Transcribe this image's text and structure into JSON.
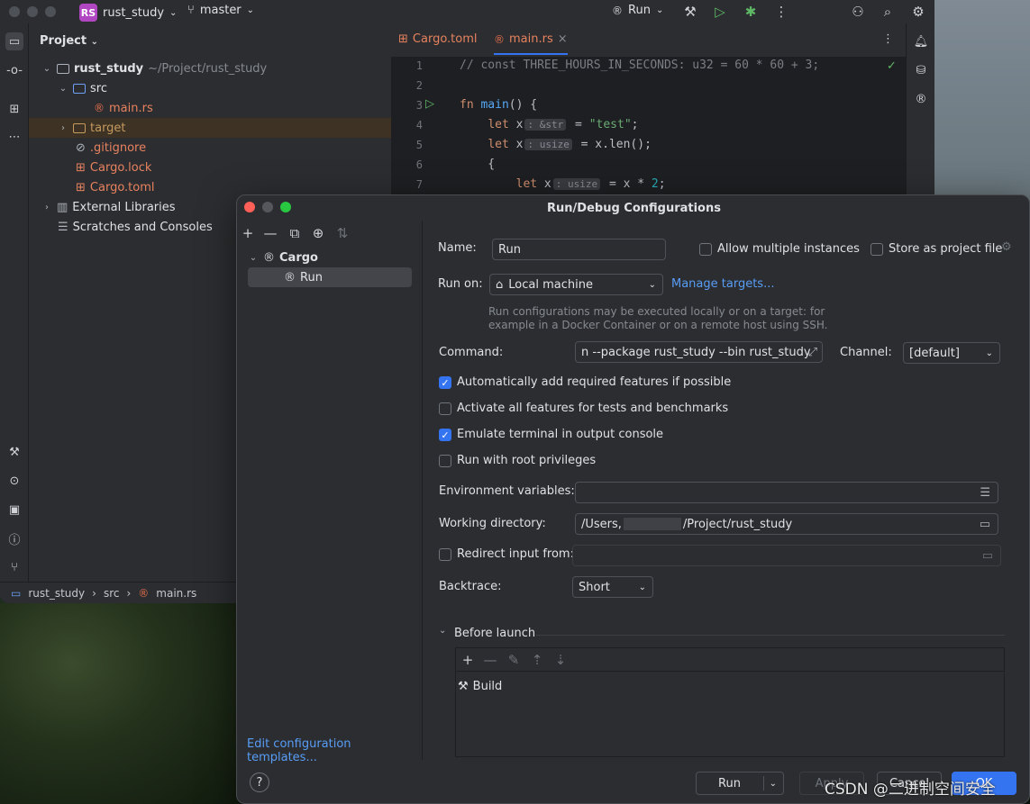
{
  "titlebar": {
    "project_badge": "RS",
    "project_name": "rust_study",
    "branch": "master",
    "run_label": "Run"
  },
  "project_panel": {
    "title": "Project",
    "root_name": "rust_study",
    "root_path": "~/Project/rust_study",
    "items": [
      "src",
      "main.rs",
      "target",
      ".gitignore",
      "Cargo.lock",
      "Cargo.toml",
      "External Libraries",
      "Scratches and Consoles"
    ]
  },
  "editor": {
    "tabs": [
      "Cargo.toml",
      "main.rs"
    ],
    "line_numbers": [
      "1",
      "2",
      "3",
      "4",
      "5",
      "6",
      "7"
    ],
    "hints": {
      "h1": ": &str",
      "h2": ": usize",
      "h3": ": usize"
    }
  },
  "breadcrumb": {
    "items": [
      "rust_study",
      "src",
      "main.rs"
    ]
  },
  "dialog": {
    "title": "Run/Debug Configurations",
    "tree_group": "Cargo",
    "tree_item": "Run",
    "edit_templates": "Edit configuration templates...",
    "name_label": "Name:",
    "name_value": "Run",
    "allow_multiple": "Allow multiple instances",
    "store_project": "Store as project file",
    "run_on_label": "Run on:",
    "run_on_value": "Local machine",
    "manage_targets": "Manage targets...",
    "run_on_hint_1": "Run configurations may be executed locally or on a target: for",
    "run_on_hint_2": "example in a Docker Container or on a remote host using SSH.",
    "command_label": "Command:",
    "command_value": "n --package rust_study --bin rust_study",
    "channel_label": "Channel:",
    "channel_value": "[default]",
    "cb_auto_features": "Automatically add required features if possible",
    "cb_all_features": "Activate all features for tests and benchmarks",
    "cb_emulate_terminal": "Emulate terminal in output console",
    "cb_root": "Run with root privileges",
    "env_label": "Environment variables:",
    "wd_label": "Working directory:",
    "wd_value_1": "/Users,",
    "wd_value_2": "/Project/rust_study",
    "redirect_label": "Redirect input from:",
    "backtrace_label": "Backtrace:",
    "backtrace_value": "Short",
    "before_launch": "Before launch",
    "build_task": "Build",
    "btn_run": "Run",
    "btn_apply": "Apply",
    "btn_cancel": "Cancel",
    "btn_ok": "OK",
    "help": "?"
  },
  "watermark": "CSDN @二进制空间安全"
}
